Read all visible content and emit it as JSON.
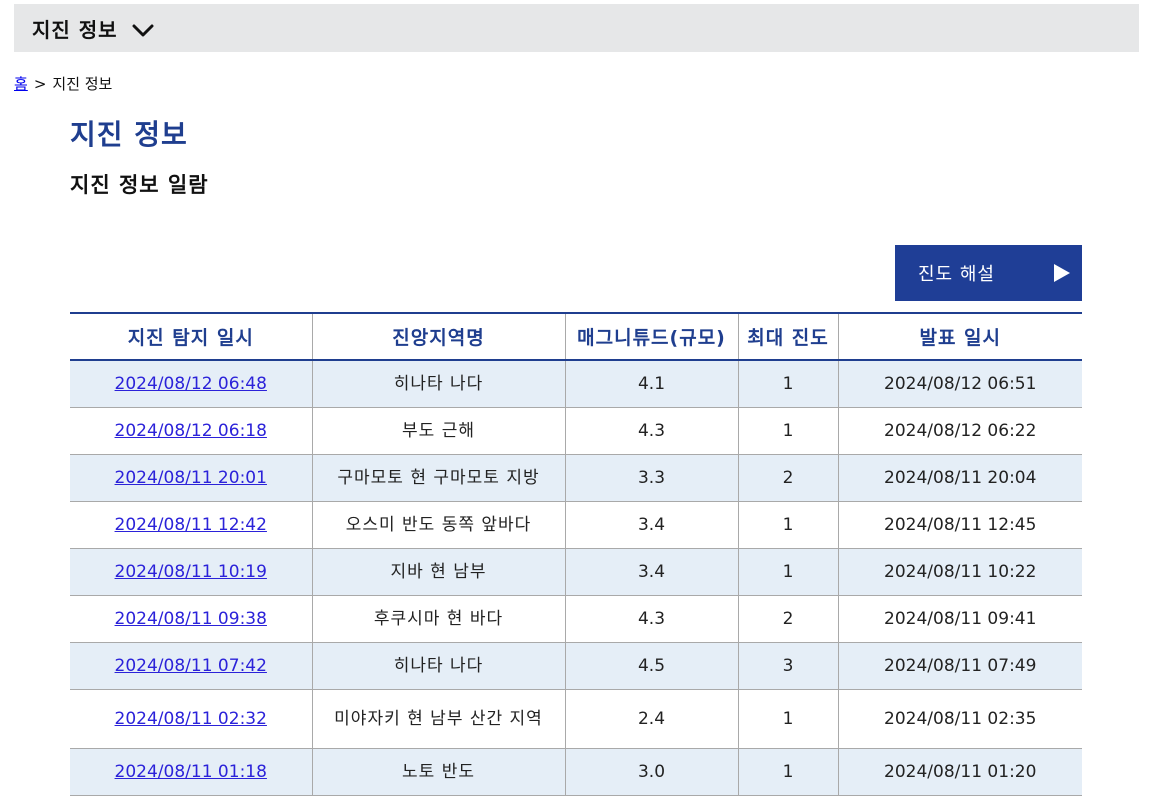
{
  "header": {
    "title": "지진 정보"
  },
  "breadcrumb": {
    "home": "홈",
    "separator": ">",
    "current": "지진 정보"
  },
  "page": {
    "title": "지진 정보",
    "subtitle": "지진 정보 일람"
  },
  "intensity_button": {
    "label": "진도 해설"
  },
  "table": {
    "columns": [
      "지진 탐지 일시",
      "진앙지역명",
      "매그니튜드(규모)",
      "최대 진도",
      "발표 일시"
    ],
    "rows": [
      {
        "detect": "2024/08/12 06:48",
        "region": "히나타 나다",
        "magnitude": "4.1",
        "intensity": "1",
        "announced": "2024/08/12 06:51"
      },
      {
        "detect": "2024/08/12 06:18",
        "region": "부도 근해",
        "magnitude": "4.3",
        "intensity": "1",
        "announced": "2024/08/12 06:22"
      },
      {
        "detect": "2024/08/11 20:01",
        "region": "구마모토 현 구마모토 지방",
        "magnitude": "3.3",
        "intensity": "2",
        "announced": "2024/08/11 20:04"
      },
      {
        "detect": "2024/08/11 12:42",
        "region": "오스미 반도 동쪽 앞바다",
        "magnitude": "3.4",
        "intensity": "1",
        "announced": "2024/08/11 12:45"
      },
      {
        "detect": "2024/08/11 10:19",
        "region": "지바 현 남부",
        "magnitude": "3.4",
        "intensity": "1",
        "announced": "2024/08/11 10:22"
      },
      {
        "detect": "2024/08/11 09:38",
        "region": "후쿠시마 현 바다",
        "magnitude": "4.3",
        "intensity": "2",
        "announced": "2024/08/11 09:41"
      },
      {
        "detect": "2024/08/11 07:42",
        "region": "히나타 나다",
        "magnitude": "4.5",
        "intensity": "3",
        "announced": "2024/08/11 07:49"
      },
      {
        "detect": "2024/08/11 02:32",
        "region": "미야자키 현 남부 산간 지역",
        "magnitude": "2.4",
        "intensity": "1",
        "announced": "2024/08/11 02:35"
      },
      {
        "detect": "2024/08/11 01:18",
        "region": "노토 반도",
        "magnitude": "3.0",
        "intensity": "1",
        "announced": "2024/08/11 01:20"
      }
    ]
  }
}
